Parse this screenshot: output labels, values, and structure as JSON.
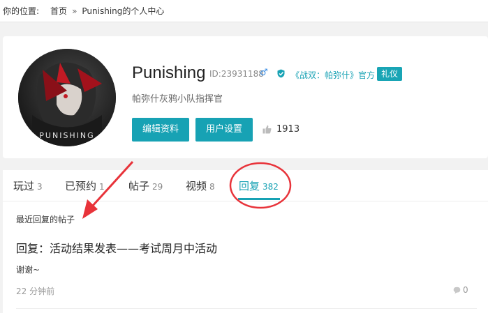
{
  "breadcrumb": {
    "label": "你的位置:",
    "home": "首页",
    "separator": "»",
    "current": "Punishing的个人中心"
  },
  "profile": {
    "avatar_text": "PUNISHING",
    "username": "Punishing",
    "uid": "ID:23931188",
    "gender_icon": "male-icon",
    "official": "《战双：帕弥什》官方",
    "badge": "礼仪",
    "bio": "帕弥什灰鸦小队指挥官",
    "edit_button": "编辑资料",
    "settings_button": "用户设置",
    "likes": "1913"
  },
  "tabs": [
    {
      "label": "玩过",
      "count": "3"
    },
    {
      "label": "已预约",
      "count": "1"
    },
    {
      "label": "帖子",
      "count": "29"
    },
    {
      "label": "视频",
      "count": "8"
    },
    {
      "label": "回复",
      "count": "382"
    }
  ],
  "active_tab": "回复",
  "replies": {
    "section_title": "最近回复的帖子",
    "items": [
      {
        "title": "回复：活动结果发表——考试周月中活动",
        "body": "谢谢~",
        "time": "22 分钟前",
        "comments": "0"
      }
    ]
  },
  "colors": {
    "accent": "#17a2b4",
    "annotation": "#e8333a"
  }
}
